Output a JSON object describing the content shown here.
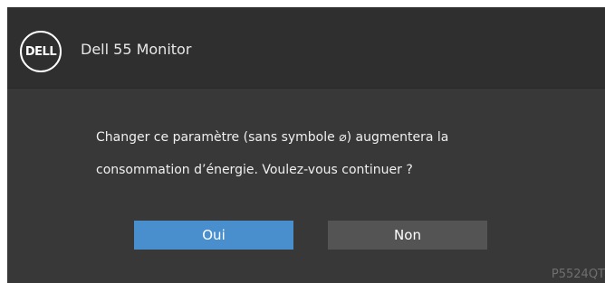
{
  "header": {
    "logo_text": "DELL",
    "title": "Dell 55 Monitor"
  },
  "dialog": {
    "line1": "Changer ce paramètre (sans symbole ⌀) augmentera la",
    "line2": "consommation d’énergie. Voulez-vous continuer ?",
    "yes_label": "Oui",
    "no_label": "Non",
    "selected": "Oui"
  },
  "footer": {
    "model": "P5524QT"
  },
  "colors": {
    "background": "#383838",
    "header": "#2f2f2f",
    "accent": "#4a8fcd",
    "button_inactive": "#545454"
  },
  "icons": {
    "logo": "dell-logo-icon"
  }
}
